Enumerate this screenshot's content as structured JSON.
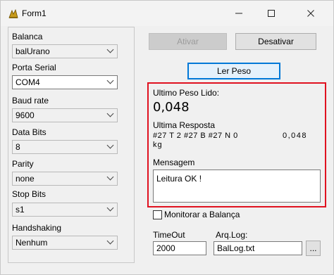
{
  "window": {
    "title": "Form1",
    "minimize": "—",
    "maximize": "☐",
    "close": "✕"
  },
  "left": {
    "balanca": {
      "label": "Balanca",
      "value": "balUrano"
    },
    "porta": {
      "label": "Porta Serial",
      "value": "COM4"
    },
    "baud": {
      "label": "Baud rate",
      "value": "9600"
    },
    "databits": {
      "label": "Data Bits",
      "value": "8"
    },
    "parity": {
      "label": "Parity",
      "value": "none"
    },
    "stopbits": {
      "label": "Stop Bits",
      "value": "s1"
    },
    "handshaking": {
      "label": "Handshaking",
      "value": "Nenhum"
    }
  },
  "buttons": {
    "ativar": "Ativar",
    "desativar": "Desativar",
    "ler_peso": "Ler Peso",
    "browse": "..."
  },
  "result": {
    "ultimo_label": "Ultimo Peso Lido:",
    "ultimo_value": "0,048",
    "resposta_label": "Ultima Resposta",
    "resposta_line1": "#27 T 2 #27 B #27 N 0",
    "resposta_value": "0,048",
    "resposta_line2": "kg",
    "mensagem_label": "Mensagem",
    "mensagem_value": "Leitura OK !"
  },
  "monitor": {
    "label": "Monitorar a Balança",
    "checked": false
  },
  "timeout": {
    "label": "TimeOut",
    "value": "2000"
  },
  "arqlog": {
    "label": "Arq.Log:",
    "value": "BalLog.txt"
  },
  "colors": {
    "highlight_border": "#e0111f",
    "focus_border": "#0078d7"
  }
}
